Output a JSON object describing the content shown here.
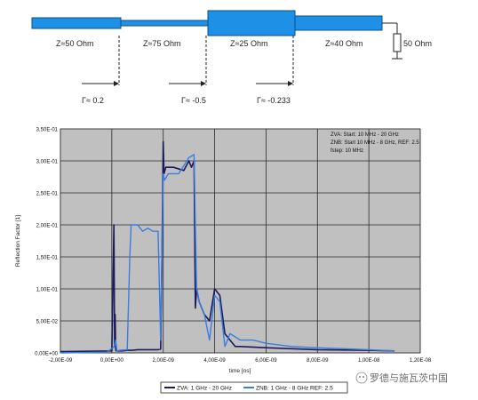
{
  "transmission_line": {
    "segments": [
      {
        "label": "Z≈50 Ohm",
        "impedance_ohm": 50
      },
      {
        "label": "Z≈75 Ohm",
        "impedance_ohm": 75
      },
      {
        "label": "Z≈25 Ohm",
        "impedance_ohm": 25
      },
      {
        "label": "Z≈40 Ohm",
        "impedance_ohm": 40
      }
    ],
    "load_label": "50 Ohm",
    "reflections": [
      {
        "label": "Γ≈ 0.2"
      },
      {
        "label": "Γ≈ -0.5"
      },
      {
        "label": "Γ≈ -0.233"
      }
    ],
    "colors": {
      "line_fill": "#1e90e6",
      "line_stroke": "#0b4f8a",
      "load": "#222222"
    }
  },
  "chart_data": {
    "type": "line",
    "xlabel": "time [ns]",
    "ylabel": "Reflection Factor [1]",
    "xlim": [
      -2e-09,
      1.2e-08
    ],
    "ylim": [
      0,
      0.35
    ],
    "x_ticks": [
      -2e-09,
      0,
      2e-09,
      4e-09,
      6e-09,
      8e-09,
      1e-08,
      1.2e-08
    ],
    "y_ticks": [
      0,
      0.05,
      0.1,
      0.15,
      0.2,
      0.25,
      0.3,
      0.35
    ],
    "x_tick_labels": [
      "-2,00E-09",
      "0,00E+00",
      "2,00E-09",
      "4,00E-09",
      "6,00E-09",
      "8,00E-09",
      "1,00E-08",
      "1,20E-08"
    ],
    "y_tick_labels": [
      "0,00E+00",
      "5,00E-02",
      "1,00E-01",
      "1,50E-01",
      "2,00E-01",
      "2,50E-01",
      "3,00E-01",
      "3,50E-01"
    ],
    "grid": true,
    "plot_background": "#c0c0c0",
    "annotation": [
      "ZVA: Start: 10 MHz - 20 GHz",
      "ZNB: Start 10 MHz - 8 GHz, REF: 2.5",
      "fstep: 10 MHz"
    ],
    "legend_position": "bottom",
    "series": [
      {
        "name": "ZVA: 1 GHz - 20 GHz",
        "color": "#1a1a5c",
        "x": [
          -2e-09,
          0,
          8e-11,
          1.1e-10,
          1.3e-10,
          1.5e-10,
          1.7e-10,
          2e-10,
          4e-10,
          6e-10,
          8e-10,
          1e-09,
          1.2e-09,
          1.4e-09,
          1.6e-09,
          1.8e-09,
          1.9e-09,
          1.95e-09,
          2e-09,
          2.03e-09,
          2.1e-09,
          2.4e-09,
          2.8e-09,
          3e-09,
          3.1e-09,
          3.2e-09,
          3.25e-09,
          3.3e-09,
          3.4e-09,
          3.6e-09,
          3.8e-09,
          4e-09,
          4.2e-09,
          4.4e-09,
          4.6e-09,
          4.8e-09,
          5e-09,
          6e-09,
          8e-09,
          1e-08,
          1.1e-08
        ],
        "y": [
          0.002,
          0.003,
          0.2,
          0.01,
          0.06,
          0.005,
          0.003,
          0.003,
          0.003,
          0.004,
          0.004,
          0.005,
          0.005,
          0.005,
          0.005,
          0.005,
          0.006,
          0.15,
          0.33,
          0.28,
          0.29,
          0.29,
          0.285,
          0.3,
          0.29,
          0.3,
          0.07,
          0.1,
          0.08,
          0.06,
          0.05,
          0.1,
          0.09,
          0.03,
          0.02,
          0.01,
          0.01,
          0.008,
          0.005,
          0.004,
          0.003
        ]
      },
      {
        "name": "ZNB: 1 GHz - 8 GHz REF: 2.5",
        "color": "#3a7de0",
        "x": [
          -2e-09,
          -2e-10,
          1e-10,
          1.5e-10,
          2e-10,
          3e-10,
          6e-10,
          7e-10,
          7.5e-10,
          8e-10,
          1e-09,
          1.2e-09,
          1.4e-09,
          1.6e-09,
          1.8e-09,
          1.9e-09,
          2e-09,
          2.05e-09,
          2.2e-09,
          2.6e-09,
          3e-09,
          3.2e-09,
          3.25e-09,
          3.3e-09,
          3.4e-09,
          3.6e-09,
          3.8e-09,
          4e-09,
          4.2e-09,
          4.4e-09,
          4.6e-09,
          5e-09,
          5.5e-09,
          6e-09,
          7e-09,
          8e-09,
          1e-08,
          1.1e-08
        ],
        "y": [
          0,
          0.001,
          0.01,
          0.02,
          0.003,
          0.004,
          0.005,
          0.15,
          0.2,
          0.2,
          0.2,
          0.19,
          0.195,
          0.19,
          0.19,
          0.02,
          0.28,
          0.27,
          0.28,
          0.28,
          0.305,
          0.31,
          0.2,
          0.1,
          0.08,
          0.06,
          0.02,
          0.09,
          0.08,
          0.01,
          0.03,
          0.02,
          0.02,
          0.015,
          0.01,
          0.008,
          0.005,
          0.003
        ]
      }
    ]
  },
  "watermark": "罗德与施瓦茨中国"
}
